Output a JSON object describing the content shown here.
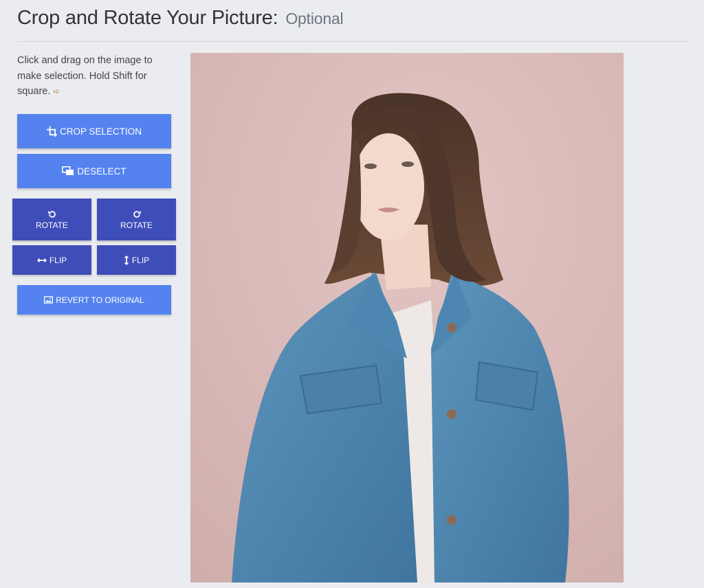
{
  "header": {
    "title": "Crop and Rotate Your Picture:",
    "subtitle": "Optional"
  },
  "instructions": {
    "text": "Click and drag on the image to make selection. Hold Shift for square."
  },
  "buttons": {
    "crop_selection": "CROP SELECTION",
    "deselect": "DESELECT",
    "rotate_left": "ROTATE",
    "rotate_right": "ROTATE",
    "flip_horizontal": "FLIP",
    "flip_vertical": "FLIP",
    "revert": "REVERT TO ORIGINAL"
  },
  "icons": {
    "crop": "crop-icon",
    "deselect": "deselect-icon",
    "rotate_left": "rotate-left-icon",
    "rotate_right": "rotate-right-icon",
    "flip_h": "arrows-horizontal-icon",
    "flip_v": "arrows-vertical-icon",
    "revert": "image-icon",
    "hint": "arrow-right-icon"
  },
  "colors": {
    "background": "#ebecf0",
    "button_primary": "#5482ef",
    "button_dark": "#3f4db8",
    "photo_backdrop": "#d9bcbb",
    "jacket": "#4f86ad"
  }
}
